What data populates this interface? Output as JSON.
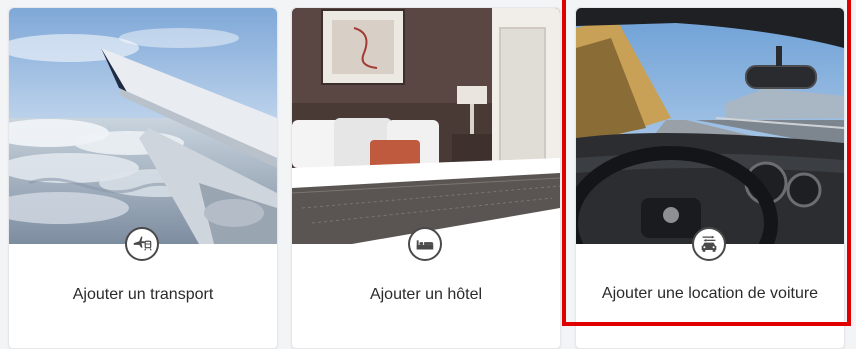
{
  "cards": [
    {
      "label": "Ajouter un transport",
      "icon": "plane-train-icon"
    },
    {
      "label": "Ajouter un hôtel",
      "icon": "bed-icon"
    },
    {
      "label": "Ajouter une location de voiture",
      "icon": "car-rental-icon",
      "highlighted": true
    }
  ],
  "colors": {
    "highlight": "#e00000",
    "icon_stroke": "#4a4a4a",
    "label_text": "#2b2b2b"
  }
}
